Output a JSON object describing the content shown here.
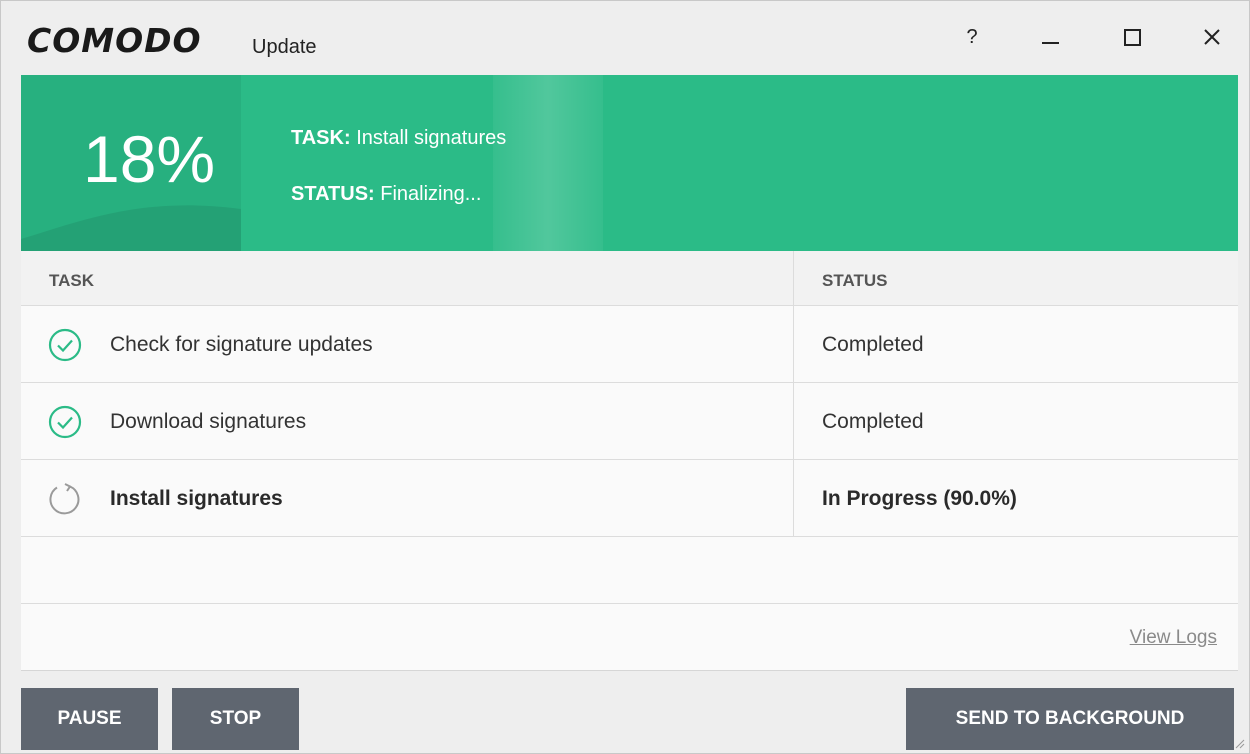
{
  "window": {
    "logo": "COMODO",
    "app_name": "Update",
    "help": "?",
    "controls": [
      "minimize",
      "maximize",
      "close"
    ]
  },
  "banner": {
    "percent": "18%",
    "progress": 0.18,
    "task_label": "TASK:",
    "task_value": "Install signatures",
    "status_label": "STATUS:",
    "status_value": "Finalizing...",
    "color": "#2bbb87"
  },
  "table": {
    "headers": {
      "task": "TASK",
      "status": "STATUS"
    },
    "rows": [
      {
        "task": "Check for signature updates",
        "status": "Completed",
        "icon": "check-circle-icon"
      },
      {
        "task": "Download signatures",
        "status": "Completed",
        "icon": "check-circle-icon"
      },
      {
        "task": "Install signatures",
        "status": "In Progress (90.0%)",
        "icon": "refresh-icon"
      }
    ],
    "view_logs": "View Logs"
  },
  "buttons": {
    "pause": "PAUSE",
    "stop": "STOP",
    "background": "SEND TO BACKGROUND",
    "color": "#5f6670"
  }
}
